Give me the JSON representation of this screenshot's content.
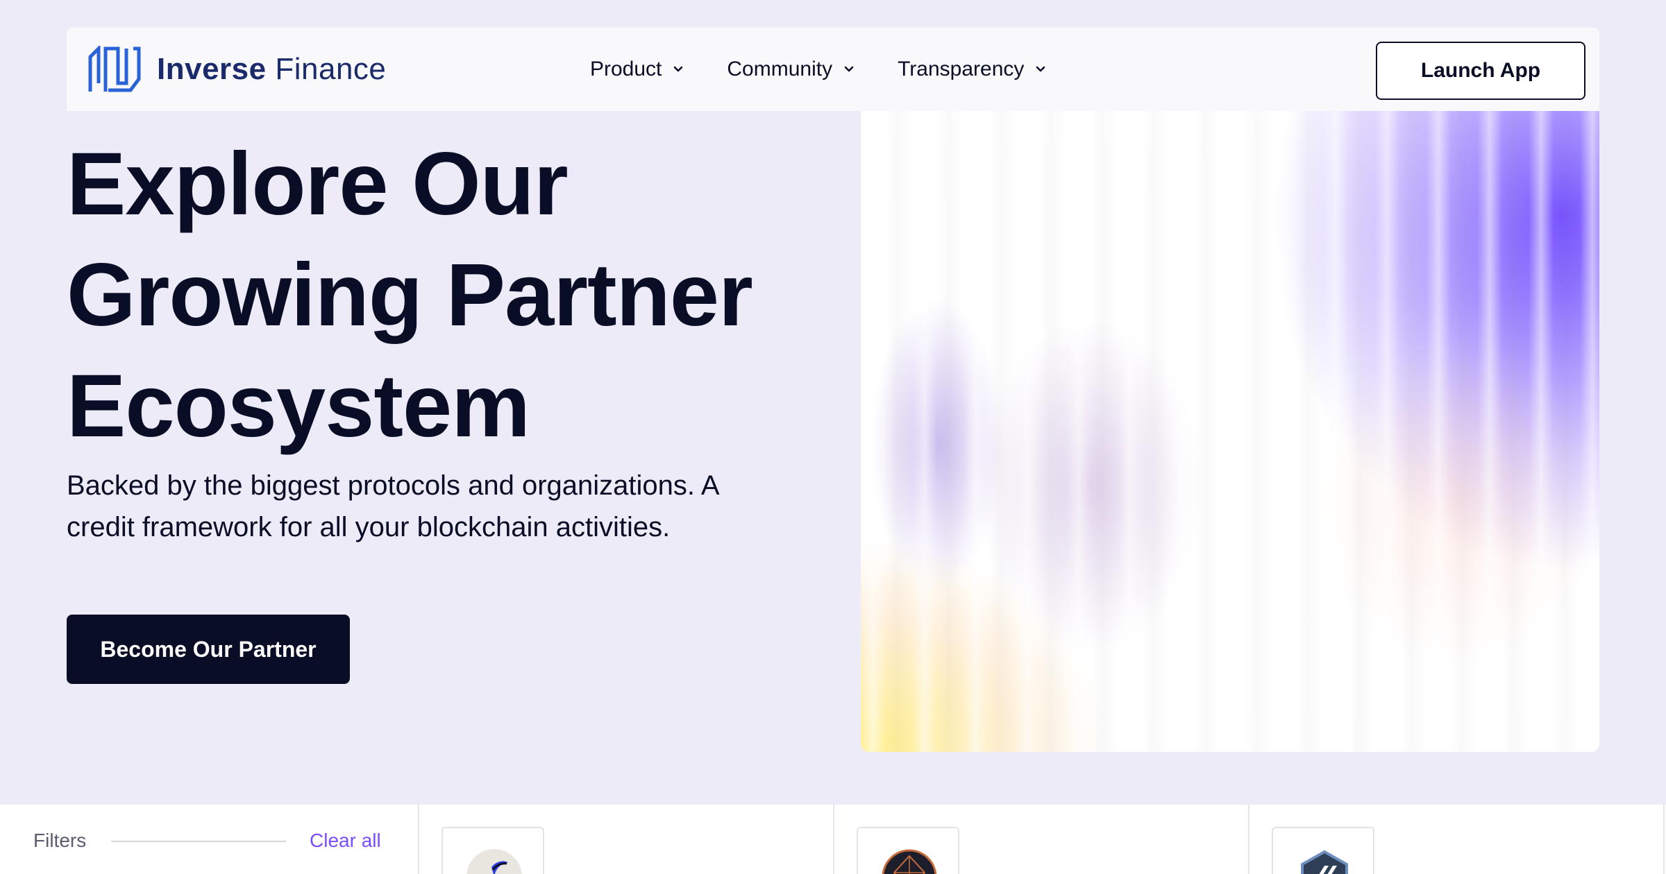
{
  "brand": {
    "name_bold": "Inverse",
    "name_regular": "Finance",
    "logo_icon": "inverse-logo-icon"
  },
  "nav": {
    "items": [
      {
        "label": "Product",
        "icon": "chevron-down-icon"
      },
      {
        "label": "Community",
        "icon": "chevron-down-icon"
      },
      {
        "label": "Transparency",
        "icon": "chevron-down-icon"
      }
    ],
    "launch_label": "Launch App"
  },
  "hero": {
    "title_lines": [
      "Explore Our",
      "Growing Partner",
      "Ecosystem"
    ],
    "subtitle": "Backed by the biggest protocols and organizations. A credit framework for all your blockchain activities.",
    "cta_label": "Become Our Partner"
  },
  "filters": {
    "label": "Filters",
    "clear_label": "Clear all"
  },
  "partners": [
    {
      "icon": "partner-logo-crescent-icon"
    },
    {
      "icon": "partner-logo-dark-circle-icon"
    },
    {
      "icon": "partner-logo-hexagon-icon"
    }
  ],
  "colors": {
    "background": "#ecebf7",
    "ink": "#0a0d26",
    "brand": "#1b2a6b",
    "accent": "#7b4dff"
  }
}
